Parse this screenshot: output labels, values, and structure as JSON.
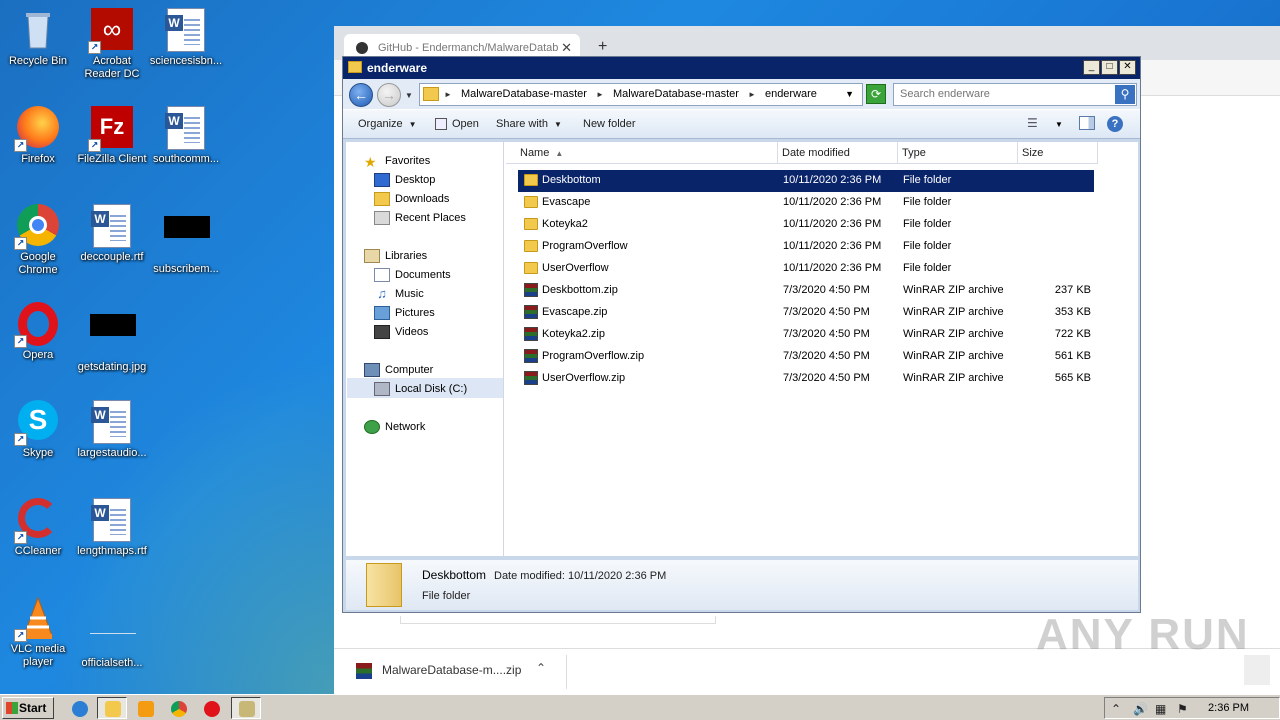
{
  "desktop": {
    "icons": [
      {
        "label": "Recycle Bin"
      },
      {
        "label": "Acrobat Reader DC"
      },
      {
        "label": "sciencesisbn..."
      },
      {
        "label": "Firefox"
      },
      {
        "label": "FileZilla Client"
      },
      {
        "label": "southcomm..."
      },
      {
        "label": "Google Chrome"
      },
      {
        "label": "deccouple.rtf"
      },
      {
        "label": "subscribem..."
      },
      {
        "label": "Opera"
      },
      {
        "label": "getsdating.jpg"
      },
      {
        "label": "Skype"
      },
      {
        "label": "largestaudio..."
      },
      {
        "label": "CCleaner"
      },
      {
        "label": "lengthmaps.rtf"
      },
      {
        "label": "VLC media player"
      },
      {
        "label": "officialseth..."
      }
    ]
  },
  "browser": {
    "tab_title": "GitHub - Endermanch/MalwareDatab",
    "download_item": "MalwareDatabase-m....zip"
  },
  "explorer": {
    "title": "enderware",
    "breadcrumb": [
      "MalwareDatabase-master",
      "MalwareDatabase-master",
      "enderware"
    ],
    "search_placeholder": "Search enderware",
    "toolbar": {
      "organize": "Organize",
      "open": "Open",
      "share_with": "Share with",
      "new_folder": "New folder"
    },
    "nav": {
      "favorites": "Favorites",
      "desktop": "Desktop",
      "downloads": "Downloads",
      "recent_places": "Recent Places",
      "libraries": "Libraries",
      "documents": "Documents",
      "music": "Music",
      "pictures": "Pictures",
      "videos": "Videos",
      "computer": "Computer",
      "local_disk": "Local Disk (C:)",
      "network": "Network"
    },
    "columns": {
      "name": "Name",
      "date_modified": "Date modified",
      "type": "Type",
      "size": "Size"
    },
    "files": [
      {
        "name": "Deskbottom",
        "date": "10/11/2020 2:36 PM",
        "type": "File folder",
        "size": "",
        "kind": "folder"
      },
      {
        "name": "Evascape",
        "date": "10/11/2020 2:36 PM",
        "type": "File folder",
        "size": "",
        "kind": "folder"
      },
      {
        "name": "Koteyka2",
        "date": "10/11/2020 2:36 PM",
        "type": "File folder",
        "size": "",
        "kind": "folder"
      },
      {
        "name": "ProgramOverflow",
        "date": "10/11/2020 2:36 PM",
        "type": "File folder",
        "size": "",
        "kind": "folder"
      },
      {
        "name": "UserOverflow",
        "date": "10/11/2020 2:36 PM",
        "type": "File folder",
        "size": "",
        "kind": "folder"
      },
      {
        "name": "Deskbottom.zip",
        "date": "7/3/2020 4:50 PM",
        "type": "WinRAR ZIP archive",
        "size": "237 KB",
        "kind": "zip"
      },
      {
        "name": "Evascape.zip",
        "date": "7/3/2020 4:50 PM",
        "type": "WinRAR ZIP archive",
        "size": "353 KB",
        "kind": "zip"
      },
      {
        "name": "Koteyka2.zip",
        "date": "7/3/2020 4:50 PM",
        "type": "WinRAR ZIP archive",
        "size": "722 KB",
        "kind": "zip"
      },
      {
        "name": "ProgramOverflow.zip",
        "date": "7/3/2020 4:50 PM",
        "type": "WinRAR ZIP archive",
        "size": "561 KB",
        "kind": "zip"
      },
      {
        "name": "UserOverflow.zip",
        "date": "7/3/2020 4:50 PM",
        "type": "WinRAR ZIP archive",
        "size": "565 KB",
        "kind": "zip"
      }
    ],
    "details": {
      "name": "Deskbottom",
      "modified": "Date modified: 10/11/2020 2:36 PM",
      "type": "File folder"
    }
  },
  "taskbar": {
    "start": "Start",
    "clock": "2:36 PM"
  },
  "watermark": "ANY RUN"
}
